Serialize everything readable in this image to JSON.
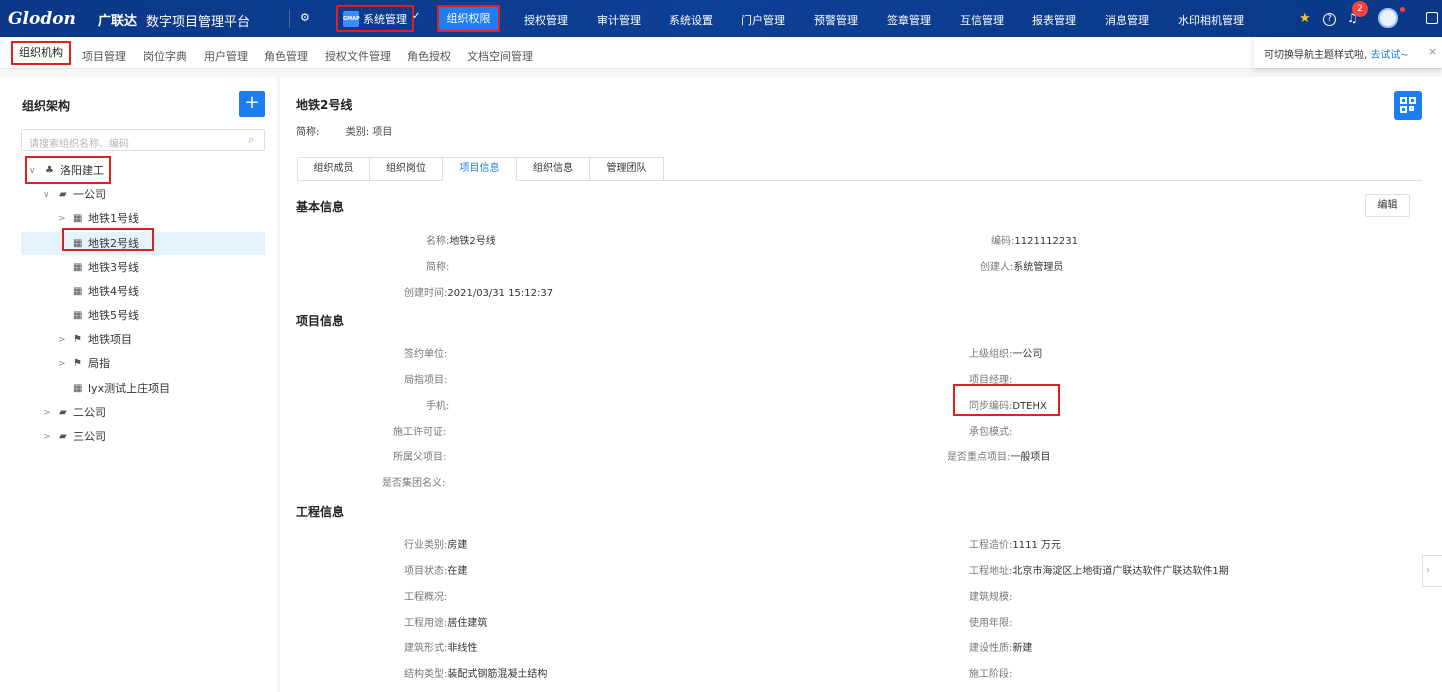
{
  "topnav": {
    "logo": "Glodon",
    "logo_cn": "广联达",
    "platform": "数字项目管理平台",
    "system_label": "系统管理",
    "system_logo": "GMAP",
    "items": [
      "组织权限",
      "授权管理",
      "审计管理",
      "系统设置",
      "门户管理",
      "预警管理",
      "签章管理",
      "互信管理",
      "报表管理",
      "消息管理",
      "水印相机管理"
    ],
    "active": "组织权限",
    "badge_count": "2",
    "icons": [
      "org-switch-icon",
      "star-icon",
      "help-icon",
      "bell-icon",
      "avatar",
      "export-icon"
    ]
  },
  "subnav": {
    "items": [
      "组织机构",
      "项目管理",
      "岗位字典",
      "用户管理",
      "角色管理",
      "授权文件管理",
      "角色授权",
      "文档空间管理"
    ],
    "active": "组织机构",
    "tip_text": "可切换导航主题样式啦, ",
    "tip_link": "去试试~",
    "tip_close": "×"
  },
  "tree": {
    "title": "组织架构",
    "add_label": "+",
    "search_placeholder": "请搜索组织名称、编码",
    "nodes": [
      {
        "label": "洛阳建工",
        "chev": "∨",
        "icon": "org-icon"
      },
      {
        "label": "一公司",
        "chev": "∨",
        "icon": "folder-open-icon"
      },
      {
        "label": "地铁1号线",
        "chev": ">",
        "icon": "building-icon"
      },
      {
        "label": "地铁2号线",
        "chev": "",
        "icon": "building-icon"
      },
      {
        "label": "地铁3号线",
        "chev": "",
        "icon": "building-icon"
      },
      {
        "label": "地铁4号线",
        "chev": "",
        "icon": "building-icon"
      },
      {
        "label": "地铁5号线",
        "chev": "",
        "icon": "building-icon"
      },
      {
        "label": "地铁项目",
        "chev": ">",
        "icon": "flag-icon"
      },
      {
        "label": "局指",
        "chev": ">",
        "icon": "flag-icon"
      },
      {
        "label": "lyx测试上庄项目",
        "chev": "",
        "icon": "building-icon"
      },
      {
        "label": "二公司",
        "chev": ">",
        "icon": "folder-icon"
      },
      {
        "label": "三公司",
        "chev": ">",
        "icon": "folder-icon"
      }
    ]
  },
  "detail": {
    "title": "地铁2号线",
    "short_name_label": "简称:",
    "category_label": "类别:",
    "category_value": "项目",
    "tabs": [
      "组织成员",
      "组织岗位",
      "项目信息",
      "组织信息",
      "管理团队"
    ],
    "active_tab": "项目信息",
    "edit_label": "编辑",
    "sections": {
      "basic": "基本信息",
      "project": "项目信息",
      "engineering": "工程信息"
    },
    "basic_fields": {
      "name_label": "名称:",
      "name_value": "地铁2号线",
      "code_label": "编码:",
      "code_value": "1121112231",
      "short_label": "简称:",
      "short_value": "",
      "creator_label": "创建人:",
      "creator_value": "系统管理员",
      "created_label": "创建时间:",
      "created_value": "2021/03/31 15:12:37"
    },
    "project_fields": {
      "contract_label": "签约单位:",
      "contract_value": "",
      "parent_label": "上级组织:",
      "parent_value": "一公司",
      "bureau_label": "局指项目:",
      "bureau_value": "",
      "manager_label": "项目经理:",
      "manager_value": "",
      "phone_label": "手机:",
      "phone_value": "",
      "sync_label": "同步编码:",
      "sync_value": "DTEHX",
      "permit_label": "施工许可证:",
      "permit_value": "",
      "mode_label": "承包模式:",
      "mode_value": "",
      "parentproj_label": "所属父项目:",
      "parentproj_value": "",
      "key_label": "是否重点项目:",
      "key_value": "一般项目",
      "group_label": "是否集团名义:",
      "group_value": ""
    },
    "eng_fields": {
      "industry_label": "行业类别:",
      "industry_value": "房建",
      "cost_label": "工程造价:",
      "cost_value": "1111 万元",
      "status_label": "项目状态:",
      "status_value": "在建",
      "address_label": "工程地址:",
      "address_value": "北京市海淀区上地街道广联达软件广联达软件1期",
      "overview_label": "工程概况:",
      "overview_value": "",
      "scale_label": "建筑规模:",
      "scale_value": "",
      "use_label": "工程用途:",
      "use_value": "居住建筑",
      "years_label": "使用年限:",
      "years_value": "",
      "form_label": "建筑形式:",
      "form_value": "非线性",
      "nature_label": "建设性质:",
      "nature_value": "新建",
      "structure_label": "结构类型:",
      "structure_value": "装配式钢筋混凝土结构",
      "stage_label": "施工阶段:",
      "stage_value": ""
    }
  },
  "colors": {
    "nav_bg": "#0c3b8f",
    "accent": "#1e7df0",
    "highlight": "#e02020",
    "selected_bg": "#e6f2fe"
  }
}
